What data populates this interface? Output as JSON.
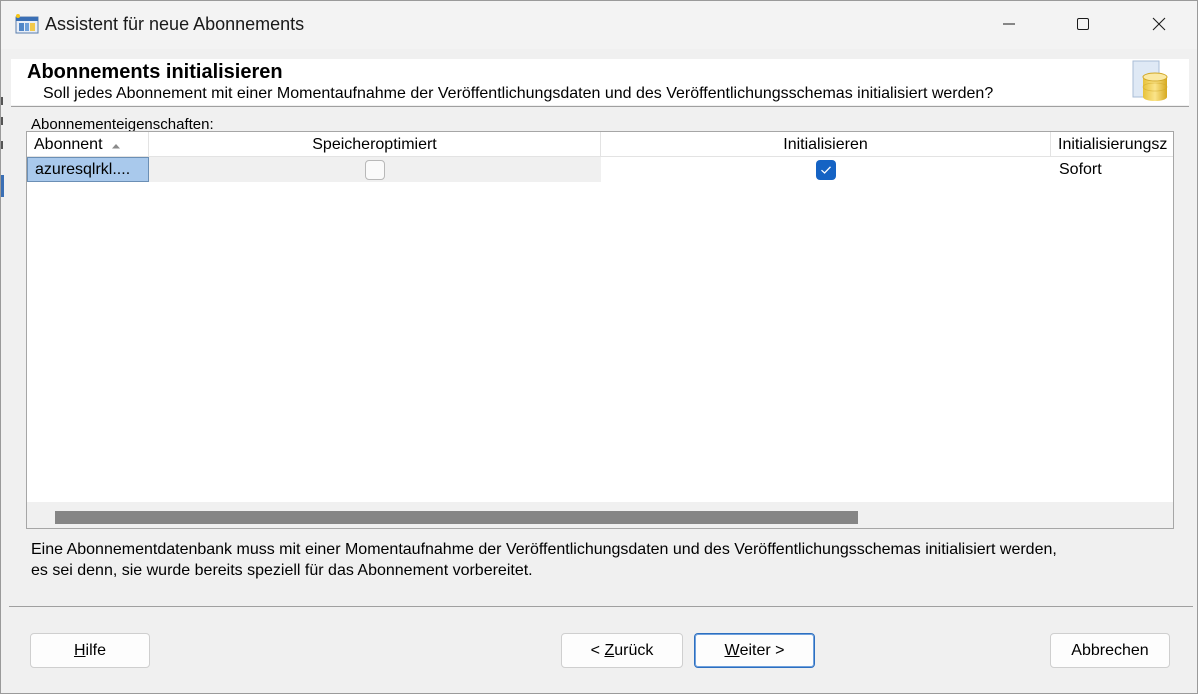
{
  "window": {
    "title": "Assistent für neue Abonnements"
  },
  "header": {
    "title": "Abonnements initialisieren",
    "subtitle": "Soll jedes Abonnement mit einer Momentaufnahme der Veröffentlichungsdaten und des Veröffentlichungsschemas initialisiert werden?"
  },
  "grid": {
    "group_label": "Abonnementeigenschaften:",
    "columns": [
      "Abonnent",
      "Speicheroptimiert",
      "Initialisieren",
      "Initialisierungsz"
    ],
    "sorted_column": "Abonnent",
    "rows": [
      {
        "subscriber": "azuresqlrkl....",
        "memory_optimized": false,
        "initialize": true,
        "init_time": "Sofort"
      }
    ],
    "hscroll_visible_fraction": 0.71
  },
  "info": {
    "line1": "Eine Abonnementdatenbank muss mit einer Momentaufnahme der Veröffentlichungsdaten und des Veröffentlichungsschemas initialisiert werden,",
    "line2": "es sei denn, sie wurde bereits speziell für das Abonnement vorbereitet."
  },
  "buttons": {
    "help_prefix": "",
    "help_mnemonic": "H",
    "help_rest": "ilfe",
    "back_prefix": "< ",
    "back_mnemonic": "Z",
    "back_rest": "urück",
    "next_prefix": "",
    "next_mnemonic": "W",
    "next_rest": "eiter >",
    "cancel": "Abbrechen"
  },
  "colors": {
    "accent": "#1563c4",
    "selected_cell": "#a9c9ec"
  },
  "icons": [
    "app-icon",
    "minimize-icon",
    "maximize-icon",
    "close-icon",
    "wizard-header-icon",
    "sort-ascending-icon",
    "checkmark-icon"
  ]
}
